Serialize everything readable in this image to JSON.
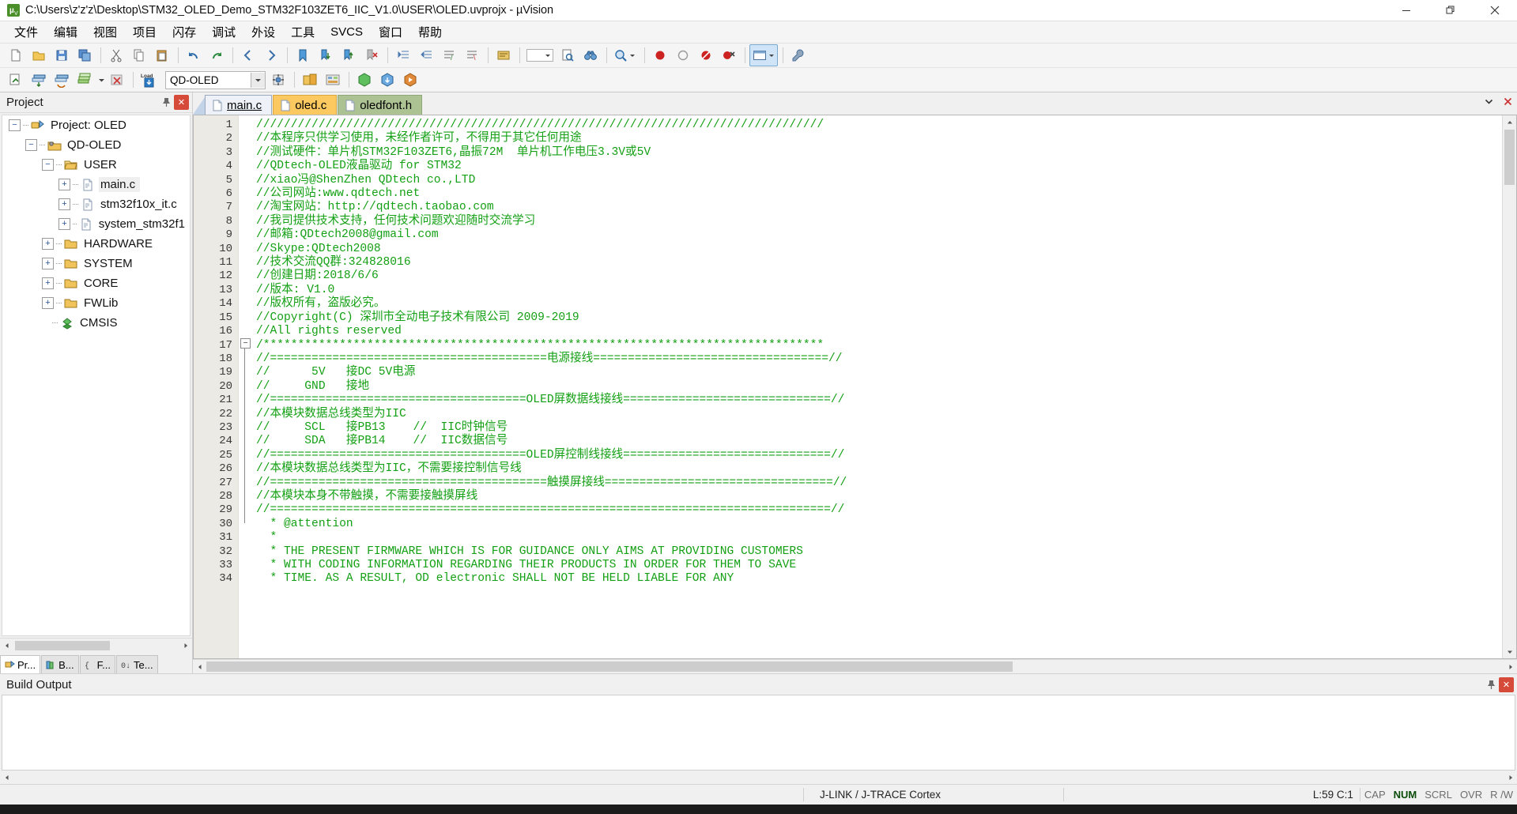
{
  "window": {
    "title": "C:\\Users\\z'z'z\\Desktop\\STM32_OLED_Demo_STM32F103ZET6_IIC_V1.0\\USER\\OLED.uvprojx - µVision",
    "app_icon": "uvision-icon",
    "minimize_label": "Minimize",
    "restore_label": "Restore",
    "close_label": "Close"
  },
  "menubar": {
    "items": [
      {
        "label": "文件",
        "accel": "文"
      },
      {
        "label": "编辑",
        "accel": "编"
      },
      {
        "label": "视图",
        "accel": "视"
      },
      {
        "label": "项目",
        "accel": "项"
      },
      {
        "label": "闪存",
        "accel": "闪"
      },
      {
        "label": "调试",
        "accel": "调"
      },
      {
        "label": "外设",
        "accel": "外"
      },
      {
        "label": "工具",
        "accel": "工"
      },
      {
        "label": "SVCS",
        "accel": "S"
      },
      {
        "label": "窗口",
        "accel": "窗"
      },
      {
        "label": "帮助",
        "accel": "帮"
      }
    ]
  },
  "toolbar_main": {
    "buttons": [
      {
        "name": "new-file-button",
        "glyph": "new"
      },
      {
        "name": "open-file-button",
        "glyph": "open"
      },
      {
        "name": "save-button",
        "glyph": "save"
      },
      {
        "name": "save-all-button",
        "glyph": "save-all"
      },
      {
        "name": "cut-button",
        "glyph": "cut"
      },
      {
        "name": "copy-button",
        "glyph": "copy"
      },
      {
        "name": "paste-button",
        "glyph": "paste"
      },
      {
        "name": "undo-button",
        "glyph": "undo"
      },
      {
        "name": "redo-button",
        "glyph": "redo"
      },
      {
        "name": "navigate-back-button",
        "glyph": "back"
      },
      {
        "name": "navigate-forward-button",
        "glyph": "forward"
      },
      {
        "name": "toggle-bookmark-button",
        "glyph": "bookmark"
      },
      {
        "name": "next-bookmark-button",
        "glyph": "bookmark-next"
      },
      {
        "name": "prev-bookmark-button",
        "glyph": "bookmark-prev"
      },
      {
        "name": "clear-bookmarks-button",
        "glyph": "bookmark-clear"
      },
      {
        "name": "indent-button",
        "glyph": "indent"
      },
      {
        "name": "outdent-button",
        "glyph": "outdent"
      },
      {
        "name": "comment-button",
        "glyph": "comment"
      },
      {
        "name": "uncomment-button",
        "glyph": "uncomment"
      },
      {
        "name": "build-target-button",
        "glyph": "build"
      },
      {
        "name": "search-dropdown",
        "glyph": "search-drop"
      },
      {
        "name": "find-in-files-button",
        "glyph": "find-files"
      },
      {
        "name": "find-button",
        "glyph": "binoculars"
      },
      {
        "name": "zoom-button",
        "glyph": "magnifier"
      },
      {
        "name": "insert-breakpoint-button",
        "glyph": "bp-red"
      },
      {
        "name": "kill-breakpoint-button",
        "glyph": "bp-hollow"
      },
      {
        "name": "disable-breakpoint-button",
        "glyph": "bp-disable"
      },
      {
        "name": "kill-all-breakpoints-button",
        "glyph": "bp-killall"
      },
      {
        "name": "configuration-wizard-button",
        "glyph": "window-panes"
      },
      {
        "name": "options-button",
        "glyph": "wrench"
      }
    ]
  },
  "toolbar_build": {
    "target_combo": {
      "value": "QD-OLED",
      "placeholder": "Select Target"
    },
    "buttons": [
      {
        "name": "translate-button",
        "glyph": "translate"
      },
      {
        "name": "build-button",
        "glyph": "build"
      },
      {
        "name": "rebuild-button",
        "glyph": "rebuild"
      },
      {
        "name": "batch-build-button",
        "glyph": "batch-build"
      },
      {
        "name": "stop-build-button",
        "glyph": "stop-build"
      },
      {
        "name": "download-button",
        "glyph": "load"
      },
      {
        "name": "target-options-button",
        "glyph": "target-options"
      },
      {
        "name": "manage-project-items-button",
        "glyph": "manage-items"
      },
      {
        "name": "manage-run-time-env-button",
        "glyph": "rte"
      },
      {
        "name": "select-software-packs-button",
        "glyph": "packs"
      },
      {
        "name": "pack-installer-button",
        "glyph": "pack-installer"
      },
      {
        "name": "start-debug-button",
        "glyph": "debug"
      }
    ]
  },
  "project_pane": {
    "title": "Project",
    "pin_icon": "pin-icon",
    "close_icon": "close-icon",
    "tree": [
      {
        "label": "Project: OLED",
        "depth": 0,
        "expander": "-",
        "icon": "project-icon",
        "selected": false
      },
      {
        "label": "QD-OLED",
        "depth": 1,
        "expander": "-",
        "icon": "target-icon",
        "selected": false
      },
      {
        "label": "USER",
        "depth": 2,
        "expander": "-",
        "icon": "folder-open-icon",
        "selected": false
      },
      {
        "label": "main.c",
        "depth": 3,
        "expander": "+",
        "icon": "c-file-icon",
        "selected": true
      },
      {
        "label": "stm32f10x_it.c",
        "depth": 3,
        "expander": "+",
        "icon": "c-file-icon",
        "selected": false
      },
      {
        "label": "system_stm32f1",
        "depth": 3,
        "expander": "+",
        "icon": "c-file-icon",
        "selected": false
      },
      {
        "label": "HARDWARE",
        "depth": 2,
        "expander": "+",
        "icon": "folder-icon",
        "selected": false
      },
      {
        "label": "SYSTEM",
        "depth": 2,
        "expander": "+",
        "icon": "folder-icon",
        "selected": false
      },
      {
        "label": "CORE",
        "depth": 2,
        "expander": "+",
        "icon": "folder-icon",
        "selected": false
      },
      {
        "label": "FWLib",
        "depth": 2,
        "expander": "+",
        "icon": "folder-icon",
        "selected": false
      },
      {
        "label": "CMSIS",
        "depth": 2,
        "expander": "",
        "icon": "cmsis-icon",
        "selected": false
      }
    ],
    "tabs": [
      {
        "label": "Pr...",
        "icon": "project-tab-icon",
        "active": true
      },
      {
        "label": "B...",
        "icon": "books-tab-icon",
        "active": false
      },
      {
        "label": "F...",
        "icon": "functions-tab-icon",
        "active": false
      },
      {
        "label": "Te...",
        "icon": "templates-tab-icon",
        "active": false
      }
    ]
  },
  "editor": {
    "tabs": [
      {
        "label": "main.c",
        "active": true,
        "color": "white"
      },
      {
        "label": "oled.c",
        "active": false,
        "color": "yellow"
      },
      {
        "label": "oledfont.h",
        "active": false,
        "color": "green"
      }
    ],
    "tab_controls": [
      {
        "name": "tab-list-dropdown-icon",
        "glyph": "▼"
      },
      {
        "name": "close-document-icon",
        "glyph": "✕"
      }
    ],
    "first_line": 1,
    "lines": [
      "//////////////////////////////////////////////////////////////////////////////////",
      "//本程序只供学习使用，未经作者许可，不得用于其它任何用途",
      "//测试硬件：单片机STM32F103ZET6,晶振72M  单片机工作电压3.3V或5V",
      "//QDtech-OLED液晶驱动 for STM32",
      "//xiao冯@ShenZhen QDtech co.,LTD",
      "//公司网站:www.qdtech.net",
      "//淘宝网站：http://qdtech.taobao.com",
      "//我司提供技术支持，任何技术问题欢迎随时交流学习",
      "//邮箱:QDtech2008@gmail.com",
      "//Skype:QDtech2008",
      "//技术交流QQ群:324828016",
      "//创建日期:2018/6/6",
      "//版本: V1.0",
      "//版权所有，盗版必究。",
      "//Copyright(C) 深圳市全动电子技术有限公司 2009-2019",
      "//All rights reserved",
      "/*********************************************************************************",
      "//========================================电源接线==================================//",
      "//      5V   接DC 5V电源",
      "//     GND   接地",
      "//=====================================OLED屏数据线接线==============================//",
      "//本模块数据总线类型为IIC",
      "//     SCL   接PB13    //  IIC时钟信号",
      "//     SDA   接PB14    //  IIC数据信号",
      "//=====================================OLED屏控制线接线==============================//",
      "//本模块数据总线类型为IIC，不需要接控制信号线",
      "//========================================触摸屏接线=================================//",
      "//本模块本身不带触摸，不需要接触摸屏线",
      "//=================================================================================//",
      "  * @attention",
      "  *",
      "  * THE PRESENT FIRMWARE WHICH IS FOR GUIDANCE ONLY AIMS AT PROVIDING CUSTOMERS",
      "  * WITH CODING INFORMATION REGARDING THEIR PRODUCTS IN ORDER FOR THEM TO SAVE",
      "  * TIME. AS A RESULT, OD electronic SHALL NOT BE HELD LIABLE FOR ANY"
    ]
  },
  "build_output": {
    "title": "Build Output",
    "pin_icon": "pin-icon",
    "close_icon": "close-icon",
    "content": ""
  },
  "statusbar": {
    "message": "",
    "debugger": "J-LINK / J-TRACE Cortex",
    "cursor": "L:59 C:1",
    "indicators": [
      {
        "label": "CAP",
        "on": false
      },
      {
        "label": "NUM",
        "on": true
      },
      {
        "label": "SCRL",
        "on": false
      },
      {
        "label": "OVR",
        "on": false
      },
      {
        "label": "R /W",
        "on": false
      }
    ]
  },
  "colors": {
    "comment_green": "#14a014",
    "tab_yellow": "#fbc95f",
    "tab_green": "#adc293",
    "close_red": "#d64a3a",
    "accent_blue": "#2b5797"
  }
}
